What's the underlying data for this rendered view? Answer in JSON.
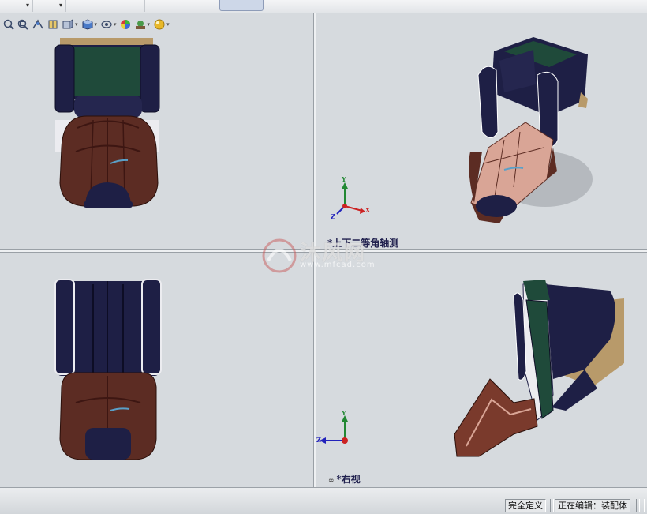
{
  "toolbar": {
    "dropdown_caret": "▾",
    "headsup_icons": [
      "zoom-to-fit-icon",
      "zoom-to-area-icon",
      "previous-view-icon",
      "section-view-icon",
      "view-orientation-icon",
      "display-style-icon",
      "hide-show-items-icon",
      "edit-appearance-icon",
      "apply-scene-icon",
      "view-settings-icon"
    ]
  },
  "viewports": {
    "top_left": {
      "name": "front-view"
    },
    "top_right": {
      "name": "isometric-view",
      "label": "*上下二等角轴测"
    },
    "bottom_left": {
      "name": "top-view"
    },
    "bottom_right": {
      "name": "right-view",
      "label": "*右视"
    }
  },
  "triad": {
    "x_label": "X",
    "y_label": "Y",
    "z_label": "Z"
  },
  "watermark": {
    "text": "沐风网",
    "url": "www.mfcad.com"
  },
  "status": {
    "definition": "完全定义",
    "editing": "正在编辑：装配体"
  },
  "colors": {
    "viewport_bg": "#d6dade",
    "seat_dark": "#1e1f45",
    "seat_green": "#1f4a3a",
    "seat_brown": "#5c2c23",
    "seat_pink": "#d9a596",
    "seat_tan": "#b89a6a",
    "axis_x": "#cc2222",
    "axis_y": "#228833",
    "axis_z": "#2222bb"
  }
}
